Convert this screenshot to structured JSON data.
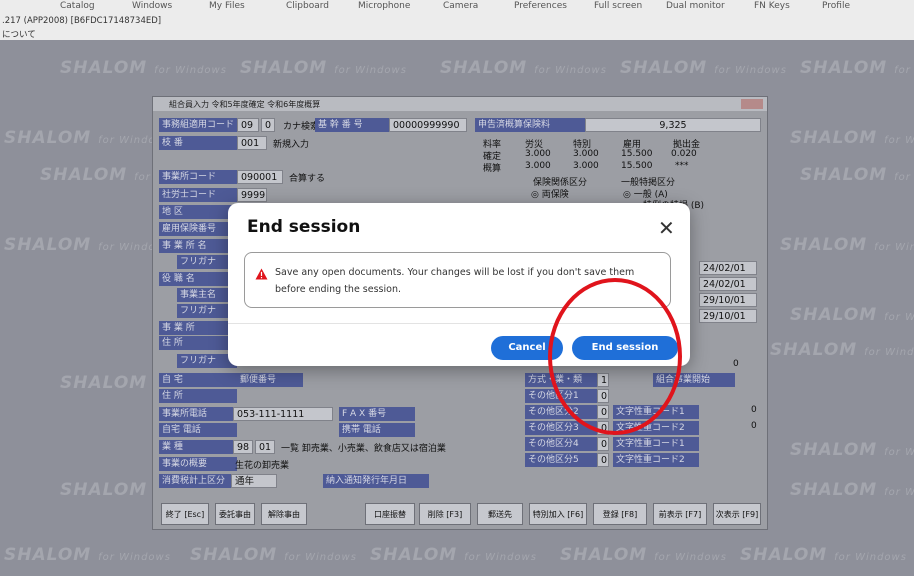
{
  "menu": {
    "items": [
      "Catalog",
      "Windows",
      "My Files",
      "Clipboard",
      "Microphone",
      "Camera",
      "Preferences",
      "Full screen",
      "Dual monitor",
      "FN Keys",
      "Profile"
    ]
  },
  "session": {
    "line": ".217 (APP2008) [B6FDC17148734ED]",
    "about": "について"
  },
  "watermark": {
    "brand": "SHALOM",
    "suffix": "for Windows"
  },
  "app": {
    "title": "組合員入力  令和5年度確定  令和6年度概算",
    "rows": {
      "label_1": "事務組適用コード",
      "val_1a": "09",
      "val_1b": "0",
      "kana_search": "カナ検索",
      "kikan_label": "基 幹 番 号",
      "kikan_value": "00000999990",
      "label_2": "枝  番",
      "val_2": "001",
      "new_input": "新規入力",
      "shinkoku_label": "申告済概算保険料",
      "shinkoku_value": "9,325",
      "rate_head": [
        "料率",
        "労災",
        "特別",
        "雇用",
        "拠出金"
      ],
      "rate_row1": [
        "確定",
        "3.000",
        "3.000",
        "15.500",
        "0.020"
      ],
      "rate_row2": [
        "概算",
        "3.000",
        "3.000",
        "15.500",
        "***"
      ],
      "office_code_label": "事業所コード",
      "office_code_value": "090001",
      "gassan": "合算する",
      "sharoushi_label": "社労士コード",
      "sharoushi_value": "9999",
      "hoken_kubun": "保険関係区分",
      "ryo_hoken": "◎ 両保険",
      "ippan_title": "一般特掲区分",
      "ippan_a": "◎ 一般 (A)",
      "tokurei": "特例の特掲 (B)",
      "chiku_label": "地  区",
      "koyo_label": "雇用保険番号",
      "jigyosho_label": "事 業 所 名",
      "furigana_1": "フリガナ",
      "yakushoku_label": "役  職  名",
      "jigyonushi_label": "事業主名",
      "furigana_2": "フリガナ",
      "jigyosho_addr_label": "事  業  所",
      "addr_label": "住  所",
      "date_1": "24/02/01",
      "date_2": "24/02/01",
      "date_3": "29/10/01",
      "date_4": "29/10/01",
      "furigana_3": "フリガナ",
      "jitaku_label": "自  宅",
      "jusho_label": "住  所",
      "yubin_label": "郵便番号",
      "tel_label": "事業所電話",
      "tel_value": "053-111-1111",
      "fax_label": "F A X 番号",
      "jitaku_tel": "自宅 電話",
      "keitai": "携帯 電話",
      "gyoshu_label": "業  種",
      "gyoshu_code_a": "98",
      "gyoshu_code_b": "01",
      "gyoshu_text": "一覧 卸売業、小売業、飲食店又は宿泊業",
      "gaiyo_label": "事業の概要",
      "gaiyo_value": "生花の卸売業",
      "shohi_label": "消費税計上区分",
      "shohi_value": "通年",
      "nofu_label": "納入通知発行年月日",
      "right_col": [
        "方式・業・類",
        "その他区分1",
        "その他区分2",
        "その他区分3",
        "その他区分4",
        "その他区分5"
      ],
      "right_vals": [
        "1",
        "0",
        "0",
        "0",
        "0",
        "0"
      ],
      "right_misc": [
        "組合事業開始",
        "文字性重コード1",
        "文字性重コード2",
        "文字性重コード1",
        "文字性重コード2"
      ],
      "zeros": [
        "0",
        "0",
        "0"
      ]
    },
    "buttons": [
      "終了 [Esc]",
      "委託事由",
      "解除事由",
      "口座振替",
      "削除 [F3]",
      "郵送先",
      "特別加入 [F6]",
      "登録 [F8]",
      "前表示 [F7]",
      "次表示 [F9]"
    ]
  },
  "dialog": {
    "title": "End session",
    "message": "Save any open documents. Your changes will be lost if you don't save them before ending the session.",
    "cancel": "Cancel",
    "confirm": "End session"
  },
  "colors": {
    "primary": "#1f6fd8",
    "warning": "#e0141c",
    "highlight_ring": "#e0141c"
  }
}
